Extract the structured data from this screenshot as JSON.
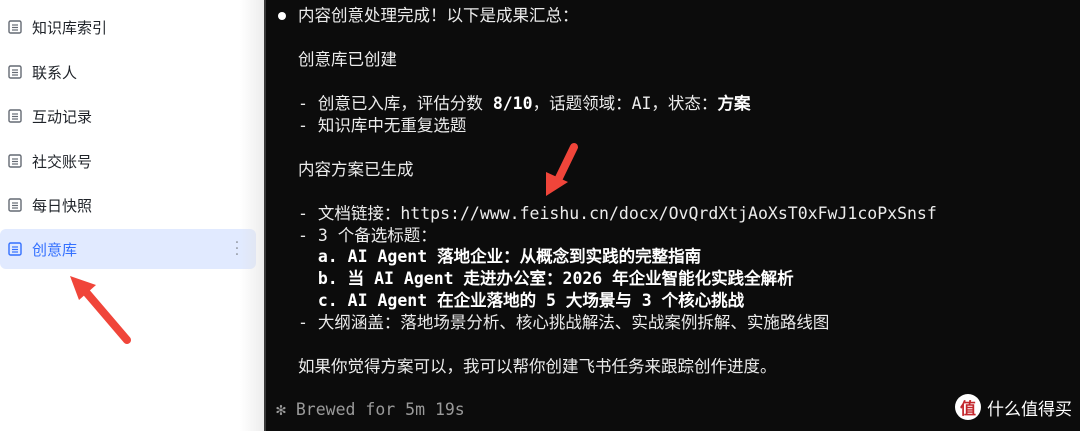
{
  "sidebar": {
    "items": [
      {
        "label": "知识库索引",
        "icon": "doc-list-icon",
        "active": false
      },
      {
        "label": "联系人",
        "icon": "doc-list-icon",
        "active": false
      },
      {
        "label": "互动记录",
        "icon": "doc-list-icon",
        "active": false
      },
      {
        "label": "社交账号",
        "icon": "doc-list-icon",
        "active": false
      },
      {
        "label": "每日快照",
        "icon": "doc-list-icon",
        "active": false
      },
      {
        "label": "创意库",
        "icon": "doc-list-icon",
        "active": true
      }
    ],
    "active_color": "#3370ff",
    "active_bg": "#e1eaff"
  },
  "terminal": {
    "status_line": "内容创意处理完成！以下是成果汇总：",
    "section1_title": "创意库已创建",
    "s1_line1_pre": "- 创意已入库，评估分数 ",
    "s1_score": "8/10",
    "s1_line1_mid": "，话题领域：AI，状态：",
    "s1_status": "方案",
    "s1_line2": "- 知识库中无重复选题",
    "section2_title": "内容方案已生成",
    "s2_link_pre": "- 文档链接：",
    "s2_link": "https://www.feishu.cn/docx/OvQrdXtjAoXsT0xFwJ1coPxSnsf",
    "s2_titles_header": "- 3 个备选标题：",
    "s2_title_a": "  a. AI Agent 落地企业：从概念到实践的完整指南",
    "s2_title_b": "  b. 当 AI Agent 走进办公室：2026 年企业智能化实践全解析",
    "s2_title_c": "  c. AI Agent 在企业落地的 5 大场景与 3 个核心挑战",
    "s2_outline": "- 大纲涵盖：落地场景分析、核心挑战解法、实战案例拆解、实施路线图",
    "closing": "如果你觉得方案可以，我可以帮你创建飞书任务来跟踪创作进度。",
    "footer": "✻ Brewed for 5m 19s"
  },
  "watermark": {
    "logo_char": "值",
    "text": "什么值得买"
  },
  "annotation_color": "#f0453a"
}
